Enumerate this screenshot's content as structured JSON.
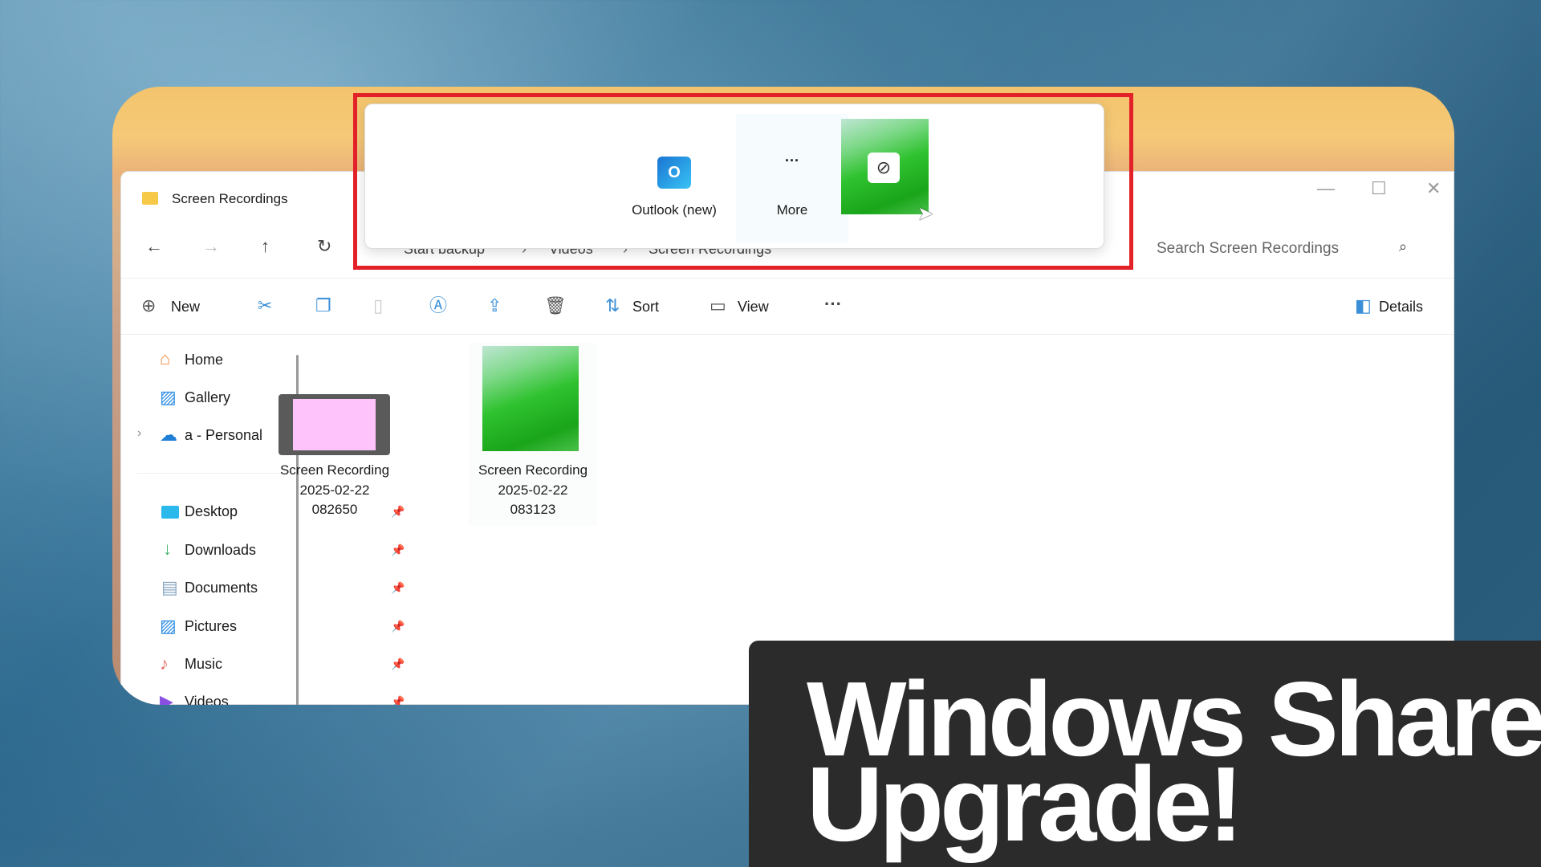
{
  "window": {
    "title": "Screen Recordings"
  },
  "nav": {
    "back": "back",
    "forward": "forward",
    "up": "up",
    "refresh": "refresh"
  },
  "breadcrumb": [
    "Start backup",
    "Videos",
    "Screen Recordings"
  ],
  "search": {
    "placeholder": "Search Screen Recordings"
  },
  "toolbar": {
    "new": "New",
    "sort": "Sort",
    "view": "View",
    "details": "Details"
  },
  "sidebar": {
    "items": [
      {
        "label": "Home"
      },
      {
        "label": "Gallery"
      },
      {
        "label": "a - Personal"
      },
      {
        "label": "Desktop"
      },
      {
        "label": "Downloads"
      },
      {
        "label": "Documents"
      },
      {
        "label": "Pictures"
      },
      {
        "label": "Music"
      },
      {
        "label": "Videos"
      }
    ]
  },
  "files": [
    {
      "name": "Screen Recording",
      "date": "2025-02-22",
      "time": "082650"
    },
    {
      "name": "Screen Recording",
      "date": "2025-02-22",
      "time": "083123"
    }
  ],
  "share": {
    "apps": [
      {
        "label": "Outlook (new)"
      },
      {
        "label": "More"
      }
    ]
  },
  "banner": {
    "line1": "Windows Share",
    "line2": "Upgrade!"
  },
  "colors": {
    "highlight": "#e32129",
    "banner_bg": "#2b2b2b",
    "accent": "#0078d4"
  }
}
